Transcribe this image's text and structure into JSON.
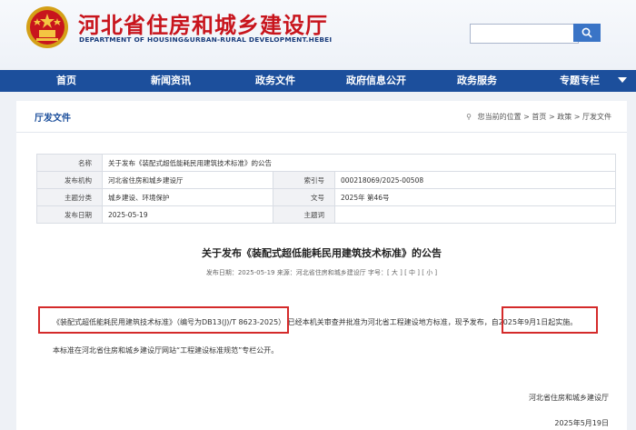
{
  "header": {
    "title": "河北省住房和城乡建设厅",
    "subtitle": "DEPARTMENT OF HOUSING&URBAN-RURAL DEVELOPMENT.HEBEI",
    "search_placeholder": ""
  },
  "nav": {
    "items": [
      "首页",
      "新闻资讯",
      "政务文件",
      "政府信息公开",
      "政务服务",
      "专题专栏"
    ]
  },
  "panel": {
    "title": "厅发文件",
    "breadcrumb": {
      "prefix": "您当前的位置",
      "items": [
        "首页",
        "政策",
        "厅发文件"
      ]
    }
  },
  "meta": {
    "name_label": "名称",
    "name_value": "关于发布《装配式超低能耗民用建筑技术标准》的公告",
    "issuer_label": "发布机构",
    "issuer_value": "河北省住房和城乡建设厅",
    "index_label": "索引号",
    "index_value": "000218069/2025-00508",
    "category_label": "主题分类",
    "category_value": "城乡建设、环境保护",
    "docno_label": "文号",
    "docno_value": "2025年 第46号",
    "date_label": "发布日期",
    "date_value": "2025-05-19",
    "subject_label": "主题词",
    "subject_value": ""
  },
  "document": {
    "title": "关于发布《装配式超低能耗民用建筑技术标准》的公告",
    "info": "发布日期：2025-05-19    来源：河北省住房和城乡建设厅    字号：[ 大 ] [ 中 ] [ 小 ]",
    "p1_standard": "《装配式超低能耗民用建筑技术标准》",
    "p1_code": "（编号为DB13(J)/T 8623-2025）",
    "p1_middle": " 已经本机关审查并批准为河北省工程建设地方标准，现予发布，",
    "p1_effective": "自2025年9月1日起实施。",
    "p2": "本标准在河北省住房和城乡建设厅网站“工程建设标准规范”专栏公开。",
    "signature": "河北省住房和城乡建设厅",
    "date": "2025年5月19日"
  },
  "colors": {
    "brand_red": "#c8151d",
    "nav_blue": "#1c4f9c",
    "highlight_red": "#d42a2a"
  }
}
